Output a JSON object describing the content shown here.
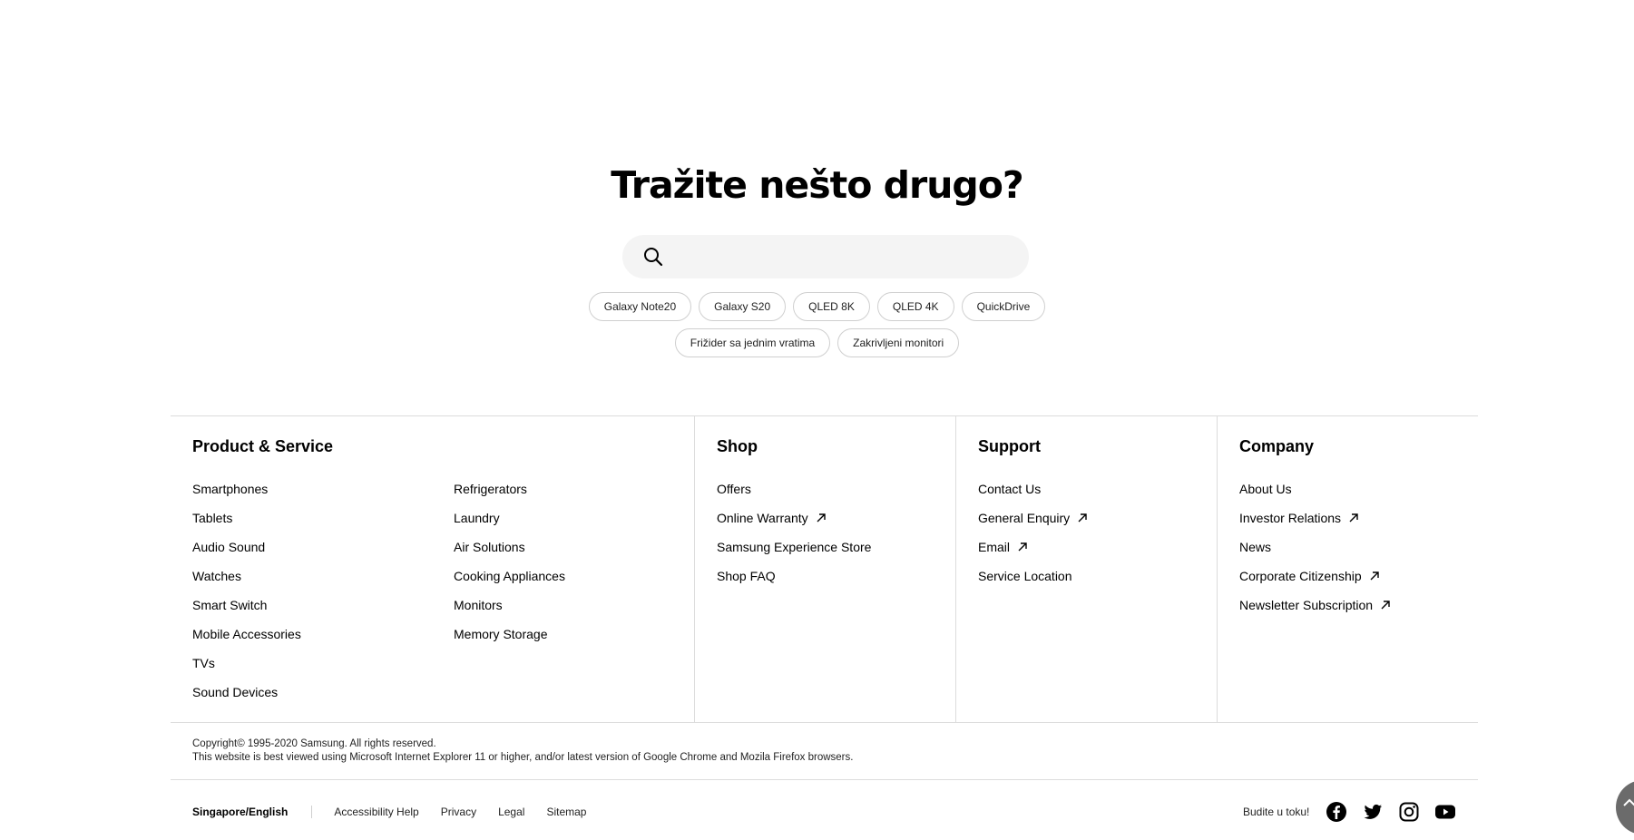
{
  "heading": "Tražite nešto drugo?",
  "search": {
    "value": "",
    "placeholder": ""
  },
  "chips_row1": [
    "Galaxy Note20",
    "Galaxy S20",
    "QLED 8K",
    "QLED 4K",
    "QuickDrive"
  ],
  "chips_row2": [
    "Frižider sa jednim vratima",
    "Zakrivljeni monitori"
  ],
  "footer": {
    "product_service": {
      "title": "Product & Service",
      "col1": [
        "Smartphones",
        "Tablets",
        "Audio Sound",
        "Watches",
        "Smart Switch",
        "Mobile Accessories",
        "TVs",
        "Sound Devices"
      ],
      "col2": [
        "Refrigerators",
        "Laundry",
        "Air Solutions",
        "Cooking Appliances",
        "Monitors",
        "Memory Storage"
      ]
    },
    "shop": {
      "title": "Shop",
      "items": [
        "Offers",
        "Online Warranty",
        "Samsung Experience Store",
        "Shop FAQ"
      ]
    },
    "support": {
      "title": "Support",
      "items": [
        "Contact Us",
        "General Enquiry",
        "Email",
        "Service Location"
      ]
    },
    "company": {
      "title": "Company",
      "items": [
        "About Us",
        "Investor Relations",
        "News",
        "Corporate Citizenship",
        "Newsletter Subscription"
      ]
    }
  },
  "copyright": {
    "line1": "Copyright© 1995-2020 Samsung. All rights reserved.",
    "line2": "This website is best viewed using Microsoft Internet Explorer 11 or higher, and/or latest version of Google Chrome and Mozila Firefox browsers."
  },
  "bottom": {
    "region": "Singapore/English",
    "links": [
      "Accessibility Help",
      "Privacy",
      "Legal",
      "Sitemap"
    ],
    "social_label": "Budite u toku!",
    "social_icons": [
      "facebook-icon",
      "twitter-icon",
      "instagram-icon",
      "youtube-icon"
    ]
  },
  "colors": {
    "search_bg": "#f4f4f4",
    "divider": "#dcdcdc",
    "scroll_button": "#6b6b6b"
  }
}
